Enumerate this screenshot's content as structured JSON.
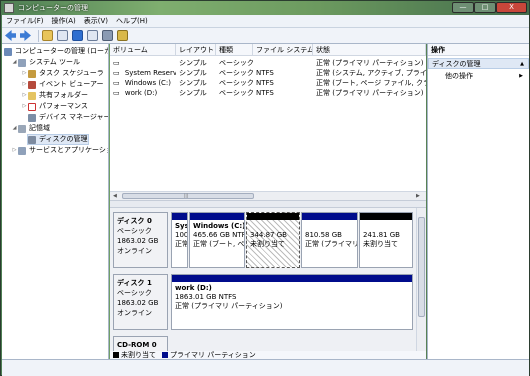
{
  "window": {
    "title": "コンピューターの管理",
    "min": "—",
    "max": "□",
    "close": "X"
  },
  "menu": [
    "ファイル(F)",
    "操作(A)",
    "表示(V)",
    "ヘルプ(H)"
  ],
  "tree": {
    "root": "コンピューターの管理 (ローカ",
    "system_tools": "システム ツール",
    "task_scheduler": "タスク スケジューラ",
    "event_viewer": "イベント ビューアー",
    "shared_folders": "共有フォルダー",
    "performance": "パフォーマンス",
    "device_manager": "デバイス マネージャー",
    "storage": "記憶域",
    "disk_management": "ディスクの管理",
    "services": "サービスとアプリケーション"
  },
  "volumes": {
    "headers": [
      "ボリューム",
      "レイアウト",
      "種類",
      "ファイル システム",
      "状態"
    ],
    "rows": [
      {
        "name": "",
        "layout": "シンプル",
        "type": "ベーシック",
        "fs": "",
        "status": "正常 (プライマリ パーティション)"
      },
      {
        "name": "System Reserved",
        "layout": "シンプル",
        "type": "ベーシック",
        "fs": "NTFS",
        "status": "正常 (システム, アクティブ, プライマ"
      },
      {
        "name": "Windows (C:)",
        "layout": "シンプル",
        "type": "ベーシック",
        "fs": "NTFS",
        "status": "正常 (ブート, ページ ファイル, クラッ"
      },
      {
        "name": "work (D:)",
        "layout": "シンプル",
        "type": "ベーシック",
        "fs": "NTFS",
        "status": "正常 (プライマリ パーティション)"
      }
    ]
  },
  "disk0": {
    "name": "ディスク 0",
    "type": "ベーシック",
    "size": "1863.02 GB",
    "state": "オンライン",
    "parts": [
      {
        "l1": "Sys",
        "l2": "100",
        "l3": "正常"
      },
      {
        "l1": "Windows (C:)",
        "l2": "465.66 GB NTF",
        "l3": "正常 (ブート, ぺ"
      },
      {
        "l1": "",
        "l2": "344.87 GB",
        "l3": "未割り当て"
      },
      {
        "l1": "",
        "l2": "810.58 GB",
        "l3": "正常 (プライマリ"
      },
      {
        "l1": "",
        "l2": "241.81 GB",
        "l3": "未割り当て"
      }
    ]
  },
  "disk1": {
    "name": "ディスク 1",
    "type": "ベーシック",
    "size": "1863.02 GB",
    "state": "オンライン",
    "part": {
      "l1": "work (D:)",
      "l2": "1863.01 GB NTFS",
      "l3": "正常 (プライマリ パーティション)"
    }
  },
  "cdrom": {
    "name": "CD-ROM 0"
  },
  "legend": {
    "unallocated": "未割り当て",
    "primary": "プライマリ パーティション"
  },
  "actions": {
    "title": "操作",
    "section": "ディスクの管理",
    "other": "他の操作"
  },
  "colors": {
    "primary": "#000c8c",
    "unallocated": "#000000"
  }
}
